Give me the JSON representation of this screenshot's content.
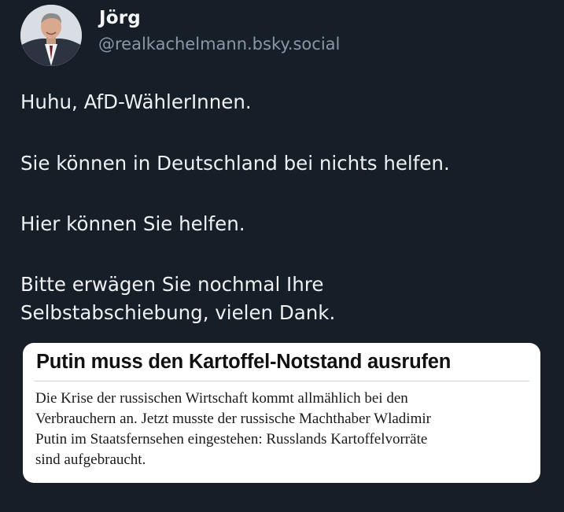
{
  "author": {
    "display_name": "Jörg",
    "handle": "@realkachelmann.bsky.social",
    "avatar_icon": "person-portrait-icon"
  },
  "post": {
    "paragraphs": [
      "Huhu, AfD-WählerInnen.",
      "Sie können in Deutschland bei nichts helfen.",
      "Hier können Sie helfen.",
      "Bitte erwägen Sie nochmal Ihre",
      "Selbstabschiebung, vielen Dank."
    ]
  },
  "embed": {
    "headline": "Putin muss den Kartoffel-Notstand ausrufen",
    "body_lines": [
      "Die Krise der russischen Wirtschaft kommt allmählich bei den",
      "Verbrauchern an. Jetzt musste der russische Machthaber Wladimir",
      "Putin im Staatsfernsehen eingestehen: Russlands Kartoffelvorräte",
      "sind aufgebraucht."
    ]
  },
  "colors": {
    "background": "#161e27",
    "text": "#eef1f4",
    "handle": "#8b97a6",
    "card_background": "#ffffff"
  }
}
